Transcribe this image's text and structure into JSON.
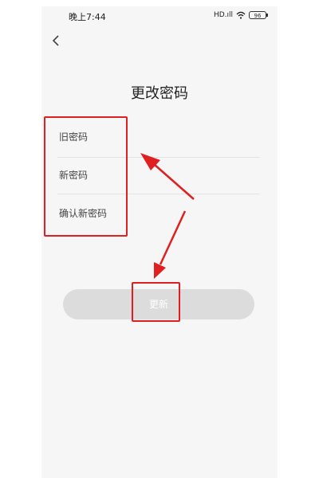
{
  "status_bar": {
    "time": "晚上7:44",
    "signal": "HD.ıll",
    "battery": "96"
  },
  "page": {
    "title": "更改密码"
  },
  "form": {
    "old_password_placeholder": "旧密码",
    "new_password_placeholder": "新密码",
    "confirm_password_placeholder": "确认新密码"
  },
  "actions": {
    "update_label": "更新"
  },
  "colors": {
    "highlight": "#e02020",
    "button_disabled": "#dcdcdc",
    "background": "#f6f6f6"
  }
}
